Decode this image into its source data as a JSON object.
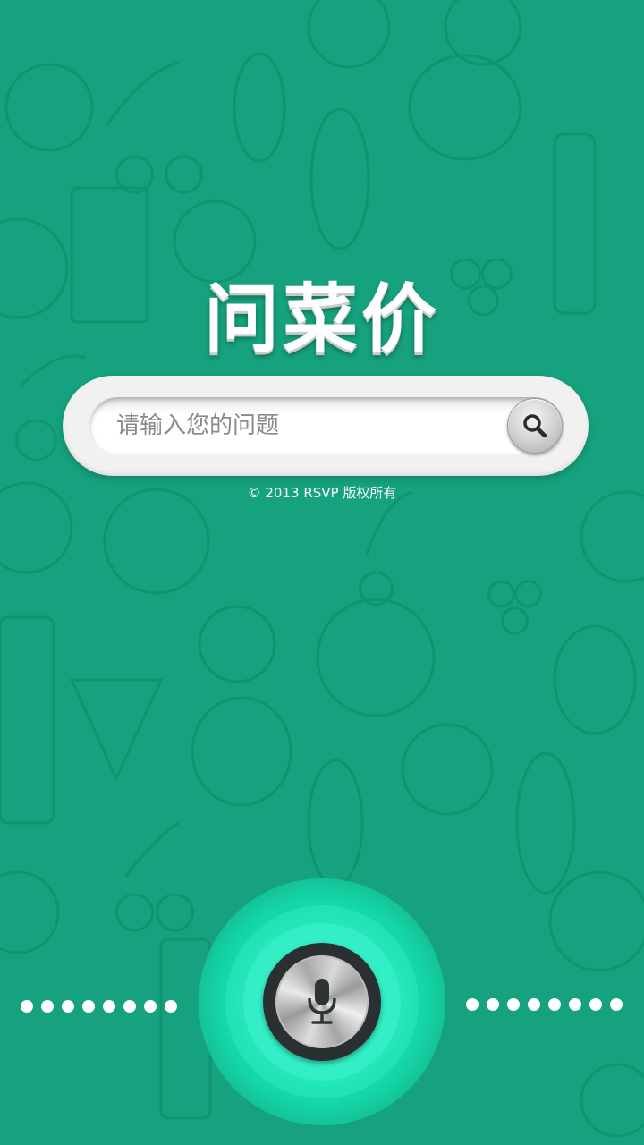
{
  "app": {
    "title": "问菜价",
    "copyright": "© 2013 RSVP 版权所有"
  },
  "search": {
    "placeholder": "请输入您的问题",
    "value": "",
    "button_icon": "search-icon"
  },
  "voice": {
    "button_icon": "microphone-icon",
    "dots_left_count": 8,
    "dots_right_count": 8
  },
  "theme": {
    "background": "#16a27e",
    "accent_glow": "#1ef5c2",
    "title_color": "#ffffff"
  }
}
